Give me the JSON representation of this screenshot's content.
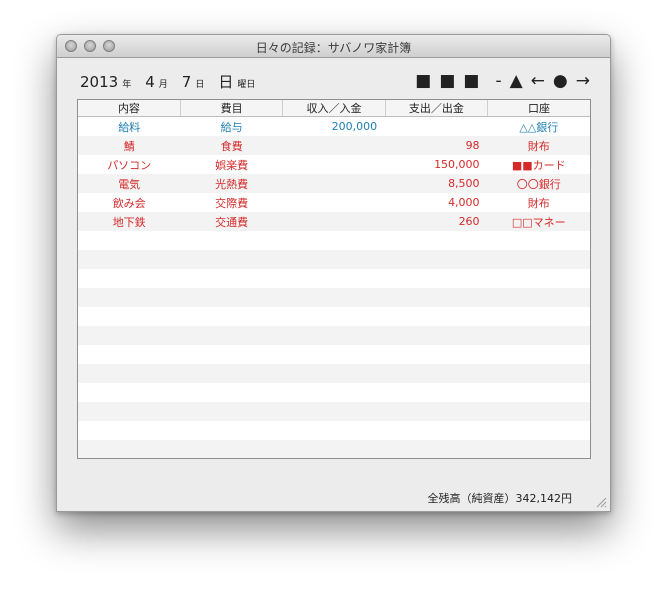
{
  "window": {
    "title": "日々の記録：サバノワ家計簿"
  },
  "date": {
    "year": "2013",
    "year_unit": "年",
    "month": "4",
    "month_unit": "月",
    "day": "7",
    "day_unit": "日",
    "weekday": "日",
    "weekday_unit": "曜日"
  },
  "toolbar": {
    "shapes": [
      "■",
      "■",
      "■",
      "-",
      "▲",
      "←",
      "●",
      "→"
    ]
  },
  "table": {
    "headers": [
      "内容",
      "費目",
      "収入／入金",
      "支出／出金",
      "口座"
    ],
    "rows": [
      {
        "type": "income",
        "content": "給料",
        "category": "給与",
        "income": "200,000",
        "expense": "",
        "account": "△△銀行"
      },
      {
        "type": "expense",
        "content": "鯖",
        "category": "食費",
        "income": "",
        "expense": "98",
        "account": "財布"
      },
      {
        "type": "expense",
        "content": "パソコン",
        "category": "娯楽費",
        "income": "",
        "expense": "150,000",
        "account": "■■カード"
      },
      {
        "type": "expense",
        "content": "電気",
        "category": "光熱費",
        "income": "",
        "expense": "8,500",
        "account": "〇〇銀行"
      },
      {
        "type": "expense",
        "content": "飲み会",
        "category": "交際費",
        "income": "",
        "expense": "4,000",
        "account": "財布"
      },
      {
        "type": "expense",
        "content": "地下鉄",
        "category": "交通費",
        "income": "",
        "expense": "260",
        "account": "□□マネー"
      }
    ]
  },
  "footer": {
    "total_label": "全残高（純資産）342,142円"
  },
  "colors": {
    "income": "#1f7fb3",
    "expense": "#d52a2a"
  }
}
